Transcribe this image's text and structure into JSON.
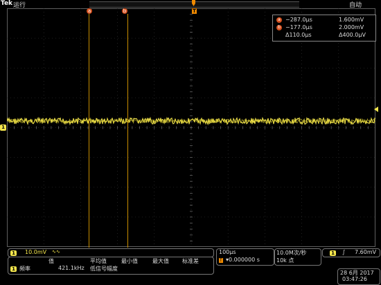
{
  "app": {
    "brand": "Tek",
    "run_state": "运行",
    "trigger_mode": "自动"
  },
  "channel": {
    "label": "1"
  },
  "cursors": {
    "a_label": "a",
    "b_label": "b",
    "trigger_label": "T"
  },
  "cursor_readout": {
    "a_time": "−287.0μs",
    "a_volt": "1.600mV",
    "b_time": "−177.0μs",
    "b_volt": "2.000mV",
    "delta_time": "Δ110.0μs",
    "delta_volt": "Δ400.0μV"
  },
  "vertical": {
    "scale": "10.0mV",
    "coupling_symbol": "∿∿"
  },
  "measurements": {
    "headers": [
      "值",
      "平均值",
      "最小值",
      "最大值",
      "标准差"
    ],
    "row_label": "频率",
    "row_value": "421.1kHz",
    "row_note": "低信号幅度"
  },
  "horizontal": {
    "scale": "100μs",
    "trigger_offset": "▾0.000000 s",
    "trigger_icon": "T"
  },
  "acquisition": {
    "sample_rate": "10.0M次/秒",
    "record_length": "10k 点"
  },
  "trigger": {
    "slope_symbol": "∫",
    "level": "7.60mV"
  },
  "datetime": {
    "date": "28 6月 2017",
    "time": "03:47:26"
  },
  "colors": {
    "ch1": "#f4e64d",
    "cursor": "#d6511f",
    "trigger": "#f08a00"
  }
}
